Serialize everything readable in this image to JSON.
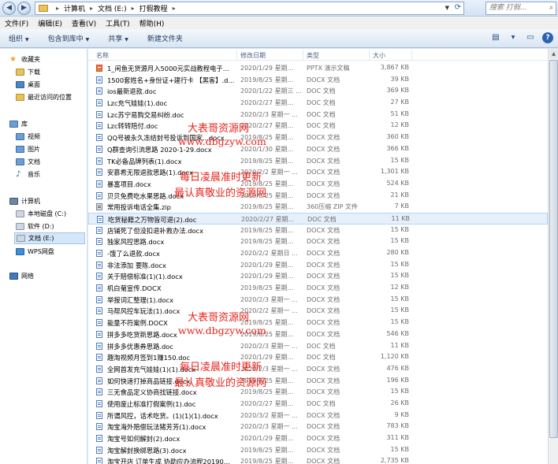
{
  "address": {
    "crumbs": [
      "计算机",
      "文档 (E:)",
      "打假教程"
    ],
    "search_placeholder": "搜索 打假..."
  },
  "menu": [
    "文件(F)",
    "编辑(E)",
    "查看(V)",
    "工具(T)",
    "帮助(H)"
  ],
  "toolbar": {
    "organize": "组织",
    "include_in_library": "包含到库中",
    "share": "共享",
    "new_folder": "新建文件夹"
  },
  "nav": {
    "favorites": "收藏夹",
    "downloads": "下载",
    "desktop": "桌面",
    "recent": "最近访问的位置",
    "libraries": "库",
    "videos": "视频",
    "pictures": "图片",
    "documents": "文档",
    "music": "音乐",
    "computer": "计算机",
    "drive_c": "本地磁盘 (C:)",
    "drive_d": "软件 (D:)",
    "drive_e": "文档 (E:)",
    "wps": "WPS网盘",
    "network": "网络"
  },
  "columns": {
    "name": "名称",
    "date": "修改日期",
    "type": "类型",
    "size": "大小"
  },
  "files": [
    {
      "name": "1_闲鱼无货源月入5000元实战教程电子...",
      "date": "2020/1/29 星期...",
      "type": "PPTX 演示文稿",
      "size": "3,867 KB",
      "icon": "ppt"
    },
    {
      "name": "1500套姓名+身份证+建行卡 【黑客】.d...",
      "date": "2019/8/25 星期...",
      "type": "DOCX 文档",
      "size": "39 KB",
      "icon": "doc"
    },
    {
      "name": "ios最新退款.doc",
      "date": "2020/1/22 星期三 ...",
      "type": "DOC 文档",
      "size": "369 KB",
      "icon": "doc"
    },
    {
      "name": "Lzc充气娃娃(1).doc",
      "date": "2020/2/27 星期...",
      "type": "DOC 文档",
      "size": "27 KB",
      "icon": "doc"
    },
    {
      "name": "Lzc苏宁易购交易纠纷.doc",
      "date": "2020/2/3 星期一 ...",
      "type": "DOC 文档",
      "size": "51 KB",
      "icon": "doc"
    },
    {
      "name": "Lzc转转陪付.doc",
      "date": "2020/2/27 星期...",
      "type": "DOC 文档",
      "size": "12 KB",
      "icon": "doc"
    },
    {
      "name": "QQ号被永久冻结封号投诉到国家...docx",
      "date": "2019/8/25 星期...",
      "type": "DOCX 文档",
      "size": "360 KB",
      "icon": "doc"
    },
    {
      "name": "Q群查询引流思路 2020-1-29.docx",
      "date": "2020/1/30 星期...",
      "type": "DOCX 文档",
      "size": "366 KB",
      "icon": "doc"
    },
    {
      "name": "TK必备品牌列表(1).docx",
      "date": "2019/8/25 星期...",
      "type": "DOCX 文档",
      "size": "15 KB",
      "icon": "doc"
    },
    {
      "name": "安慕希无限退款思路(1).docx",
      "date": "2020/2/2 星期一 ...",
      "type": "DOCX 文档",
      "size": "1,301 KB",
      "icon": "doc"
    },
    {
      "name": "暴富项目.docx",
      "date": "2019/8/25 星期...",
      "type": "DOCX 文档",
      "size": "524 KB",
      "icon": "doc"
    },
    {
      "name": "贝贝免费吃水果思路.docx",
      "date": "2019/8/25 星期...",
      "type": "DOCX 文档",
      "size": "21 KB",
      "icon": "doc"
    },
    {
      "name": "常用投诉电话全集.zip",
      "date": "2019/8/25 星期...",
      "type": "360压缩 ZIP 文件",
      "size": "7 KB",
      "icon": "zip"
    },
    {
      "name": "吃货秘籍之万物皆可退(2).doc",
      "date": "2020/2/27 星期...",
      "type": "DOC 文档",
      "size": "11 KB",
      "icon": "doc",
      "selected": true
    },
    {
      "name": "店铺死了但没扣退补救办法.docx",
      "date": "2019/8/25 星期...",
      "type": "DOCX 文档",
      "size": "15 KB",
      "icon": "doc"
    },
    {
      "name": "独家风控思路.docx",
      "date": "2019/8/25 星期...",
      "type": "DOCX 文档",
      "size": "15 KB",
      "icon": "doc"
    },
    {
      "name": "-饿了么退款.docx",
      "date": "2020/2/2 星期日 ...",
      "type": "DOCX 文档",
      "size": "280 KB",
      "icon": "doc"
    },
    {
      "name": "非法添加 要陈.docx",
      "date": "2020/1/29 星期...",
      "type": "DOCX 文档",
      "size": "15 KB",
      "icon": "doc"
    },
    {
      "name": "关于赔偿标准(1)(1).docx",
      "date": "2020/1/29 星期...",
      "type": "DOCX 文档",
      "size": "15 KB",
      "icon": "doc"
    },
    {
      "name": "机白菊宣传.DOCX",
      "date": "2019/8/25 星期...",
      "type": "DOCX 文档",
      "size": "12 KB",
      "icon": "doc"
    },
    {
      "name": "举报词汇整理(1).docx",
      "date": "2020/2/3 星期一 ...",
      "type": "DOCX 文档",
      "size": "15 KB",
      "icon": "doc"
    },
    {
      "name": "马帮风控车玩法(1).docx",
      "date": "2020/2/2 星期一 ...",
      "type": "DOCX 文档",
      "size": "15 KB",
      "icon": "doc"
    },
    {
      "name": "能量不符案例.DOCX",
      "date": "2019/8/25 星期...",
      "type": "DOCX 文档",
      "size": "15 KB",
      "icon": "doc"
    },
    {
      "name": "拼多多吃货新思路.docx",
      "date": "2019/8/25 星期...",
      "type": "DOCX 文档",
      "size": "546 KB",
      "icon": "doc"
    },
    {
      "name": "拼多多优惠券思路.doc",
      "date": "2020/2/3 星期一 ...",
      "type": "DOC 文档",
      "size": "11 KB",
      "icon": "doc"
    },
    {
      "name": "趣淘视频月签到1赚150.doc",
      "date": "2020/1/29 星期...",
      "type": "DOC 文档",
      "size": "1,120 KB",
      "icon": "doc"
    },
    {
      "name": "全网首发充气娃娃(1)(1).docx",
      "date": "2020/2/3 星期一 ...",
      "type": "DOCX 文档",
      "size": "476 KB",
      "icon": "doc"
    },
    {
      "name": "如何快速打掉商品链接.docx",
      "date": "2019/8/25 星期...",
      "type": "DOCX 文档",
      "size": "196 KB",
      "icon": "doc"
    },
    {
      "name": "三无食品定义协商找链接.docx",
      "date": "2019/8/25 星期...",
      "type": "DOCX 文档",
      "size": "15 KB",
      "icon": "doc"
    },
    {
      "name": "使用废止标准打假案例(1).doc",
      "date": "2020/2/27 星期...",
      "type": "DOC 文档",
      "size": "26 KB",
      "icon": "doc"
    },
    {
      "name": "所谓风控，话术吃货。(1)(1)(1).docx",
      "date": "2020/3/2 星期一 ...",
      "type": "DOCX 文档",
      "size": "9 KB",
      "icon": "doc"
    },
    {
      "name": "淘宝海外赔偿玩法猪芳芳(1).docx",
      "date": "2020/2/3 星期一 ...",
      "type": "DOCX 文档",
      "size": "783 KB",
      "icon": "doc"
    },
    {
      "name": "淘宝号如何解封(2).docx",
      "date": "2020/1/29 星期...",
      "type": "DOCX 文档",
      "size": "311 KB",
      "icon": "doc"
    },
    {
      "name": "淘宝解封换绑思路(3).docx",
      "date": "2019/8/25 星期...",
      "type": "DOCX 文档",
      "size": "15 KB",
      "icon": "doc"
    },
    {
      "name": "淘宝开店 订单生成 协助应办流程20190...",
      "date": "2019/8/25 星期...",
      "type": "DOCX 文档",
      "size": "2,735 KB",
      "icon": "doc"
    }
  ],
  "watermark": {
    "title": "大表哥资源网",
    "url": "www.dbgzyw.com",
    "line1": "每日凌晨准时更新",
    "line2": "最认真敬业的资源网"
  }
}
